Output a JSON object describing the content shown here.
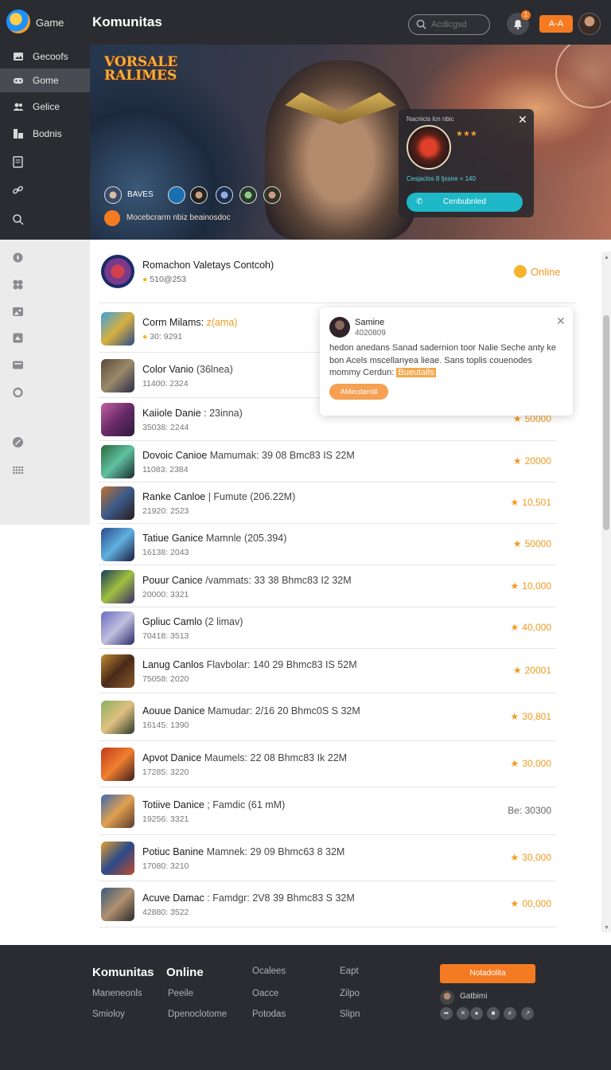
{
  "header": {
    "brand": "Game",
    "title": "Komunitas",
    "search_placeholder": "Acdicgsd",
    "notif_count": "1",
    "cta_label": "A-A",
    "avatar_icon": "user-avatar"
  },
  "sidebar": {
    "items": [
      {
        "label": "Gecoofs",
        "icon": "gallery-icon"
      },
      {
        "label": "Gome",
        "icon": "gamepad-icon"
      },
      {
        "label": "Gelice",
        "icon": "people-icon"
      },
      {
        "label": "Bodnis",
        "icon": "chart-icon"
      }
    ],
    "icons_upper": [
      "document-icon",
      "link-icon",
      "search-icon"
    ],
    "icons_lower": [
      "compass-icon",
      "puzzle-icon",
      "image-icon",
      "tag-icon",
      "card-icon",
      "refresh-icon",
      "rocket-icon",
      "grid-icon"
    ]
  },
  "hero": {
    "logo_text": "VORSALE RALIMES",
    "chip_label": "BAVES",
    "subtitle": "Mocebcrarm nbiz beainosdoc",
    "card": {
      "title": "Nacnicis lcn nbic",
      "stars": "★★★",
      "stat": "Cesjaclos 8 Ijssire = 140",
      "button": "Cenbubnled"
    }
  },
  "first_row": {
    "name": "Romachon Valetays Contcoh)",
    "sub": "510@253",
    "status": "Online"
  },
  "rows": [
    {
      "name": "Corm Milams:",
      "rest": " z(ama)",
      "sub": "30: 9291",
      "score": "",
      "accent": true
    },
    {
      "name": "Color Vanio",
      "rest": " (36lnea)",
      "sub": "11400: 2324",
      "score": ""
    },
    {
      "name": "Kaiiole Danie",
      "rest": " : 23inna)",
      "sub": "35038: 2244",
      "score": "50000"
    },
    {
      "name": "Dovoic Canioe",
      "rest": " Mamumak: 39 08 Bmc83 IS 22M",
      "sub": "11083: 2384",
      "score": "20000"
    },
    {
      "name": "Ranke Canloe",
      "rest": " | Fumute (206.22M)",
      "sub": "21920: 2523",
      "score": "10,501"
    },
    {
      "name": "Tatiue Ganice",
      "rest": " Mamnle (205.394)",
      "sub": "16138: 2043",
      "score": "50000"
    },
    {
      "name": "Pouur Canice",
      "rest": " /vammats: 33 38 Bhmc83 I2 32M",
      "sub": "20000: 3321",
      "score": "10,000"
    },
    {
      "name": "Gpliuc Camlo",
      "rest": " (2 limav)",
      "sub": "70418: 3513",
      "score": "40,000"
    },
    {
      "name": "Lanug Canlos",
      "rest": " Flavbolar: 140 29 Bhmc83 IS 52M",
      "sub": "75058: 2020",
      "score": "20001"
    },
    {
      "name": "Aouue Danice",
      "rest": " Mamudar: 2/16 20 Bhmc0S S 32M",
      "sub": "16145: 1390",
      "score": "30,801"
    },
    {
      "name": "Apvot Danice",
      "rest": " Maumels: 22 08 Bhmc83 Ik 22M",
      "sub": "17285: 3220",
      "score": "30,000"
    },
    {
      "name": "Totiive Danice",
      "rest": " ; Famdic (61 mM)",
      "sub": "19256: 3321",
      "score": "Be: 30300",
      "gray": true
    },
    {
      "name": "Potiuc Banine",
      "rest": " Mamnek: 29 09 Bhmc63 8 32M",
      "sub": "17080: 3210",
      "score": "30,000"
    },
    {
      "name": "Acuve Damac",
      "rest": " : Famdgr: 2V8 39 Bhmc83 S 32M",
      "sub": "42880: 3522",
      "score": "00,000"
    }
  ],
  "popup": {
    "name": "Samine",
    "id": "4020809",
    "text_before": "hedon anedans Sanad sadernion toor Nalie Seche anty ke bon Acels mscellanyea lieae. Sans toplis couenodes mommy Cerdun:",
    "highlight": "Bueutalls",
    "button": "AMecdemill"
  },
  "footer": {
    "brand": "Komunitas",
    "online": "Online",
    "col1": [
      "Maneneonls",
      "Smioloy"
    ],
    "col2": [
      "Peeile",
      "Dpenoclotome"
    ],
    "col3": [
      "Ocalees",
      "Oacce",
      "Potodas"
    ],
    "col4": [
      "Eapt",
      "Zilpo",
      "Slipn"
    ],
    "cta": "Notadolita",
    "user": "Gatbimi",
    "social_icons": [
      "share-icon",
      "close-icon",
      "chat-icon",
      "square-icon",
      "tag-icon",
      "rss-icon"
    ]
  },
  "colors": {
    "dark": "#2b2c31",
    "accent": "#f57b23",
    "teal": "#1fb8c8",
    "star": "#f39a1e"
  }
}
